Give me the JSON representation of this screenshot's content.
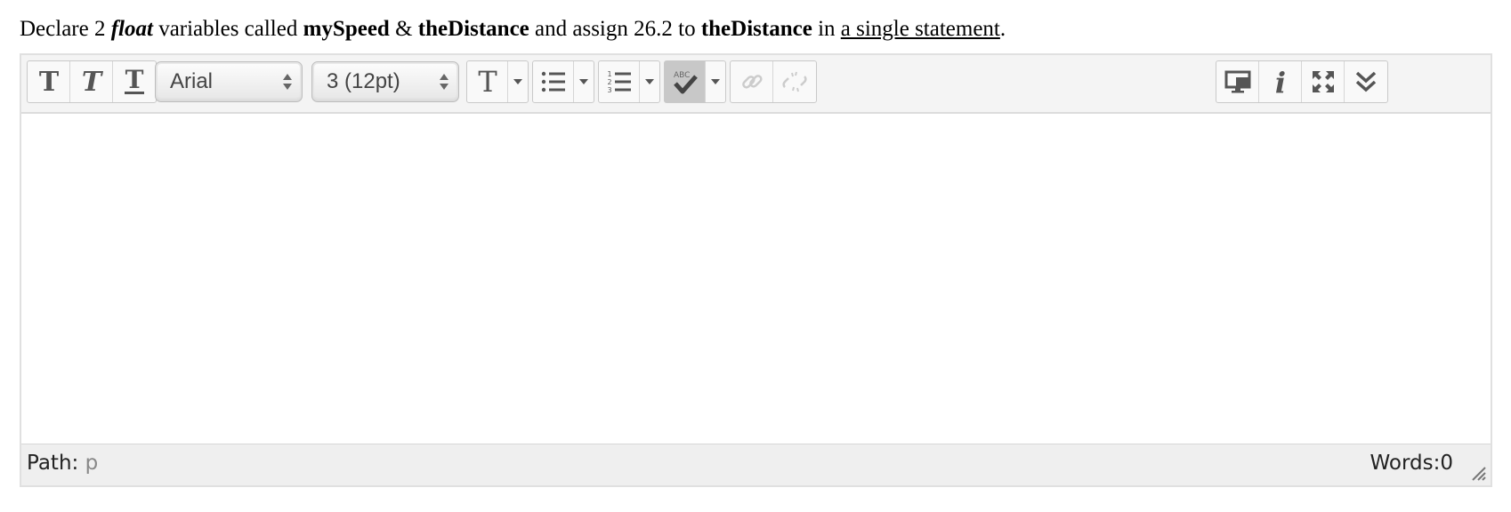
{
  "question": {
    "part1": "Declare 2 ",
    "type_word": "float",
    "part2": " variables called ",
    "var1": "mySpeed",
    "amp": " & ",
    "var2": "theDistance",
    "part3": " and assign 26.2 to ",
    "var3": "theDistance",
    "part4": " in ",
    "link": "a single statement",
    "end": "."
  },
  "toolbar": {
    "font_family": "Arial",
    "font_size": "3 (12pt)",
    "icons": [
      "bold-icon",
      "italic-icon",
      "underline-icon",
      "text-color-icon",
      "bullet-list-icon",
      "numbered-list-icon",
      "spellcheck-icon",
      "link-icon",
      "unlink-icon",
      "preview-icon",
      "info-icon",
      "fullscreen-icon",
      "expand-toolbar-icon"
    ]
  },
  "status": {
    "path_label": "Path:",
    "path_value": "p",
    "words": "Words:0"
  }
}
